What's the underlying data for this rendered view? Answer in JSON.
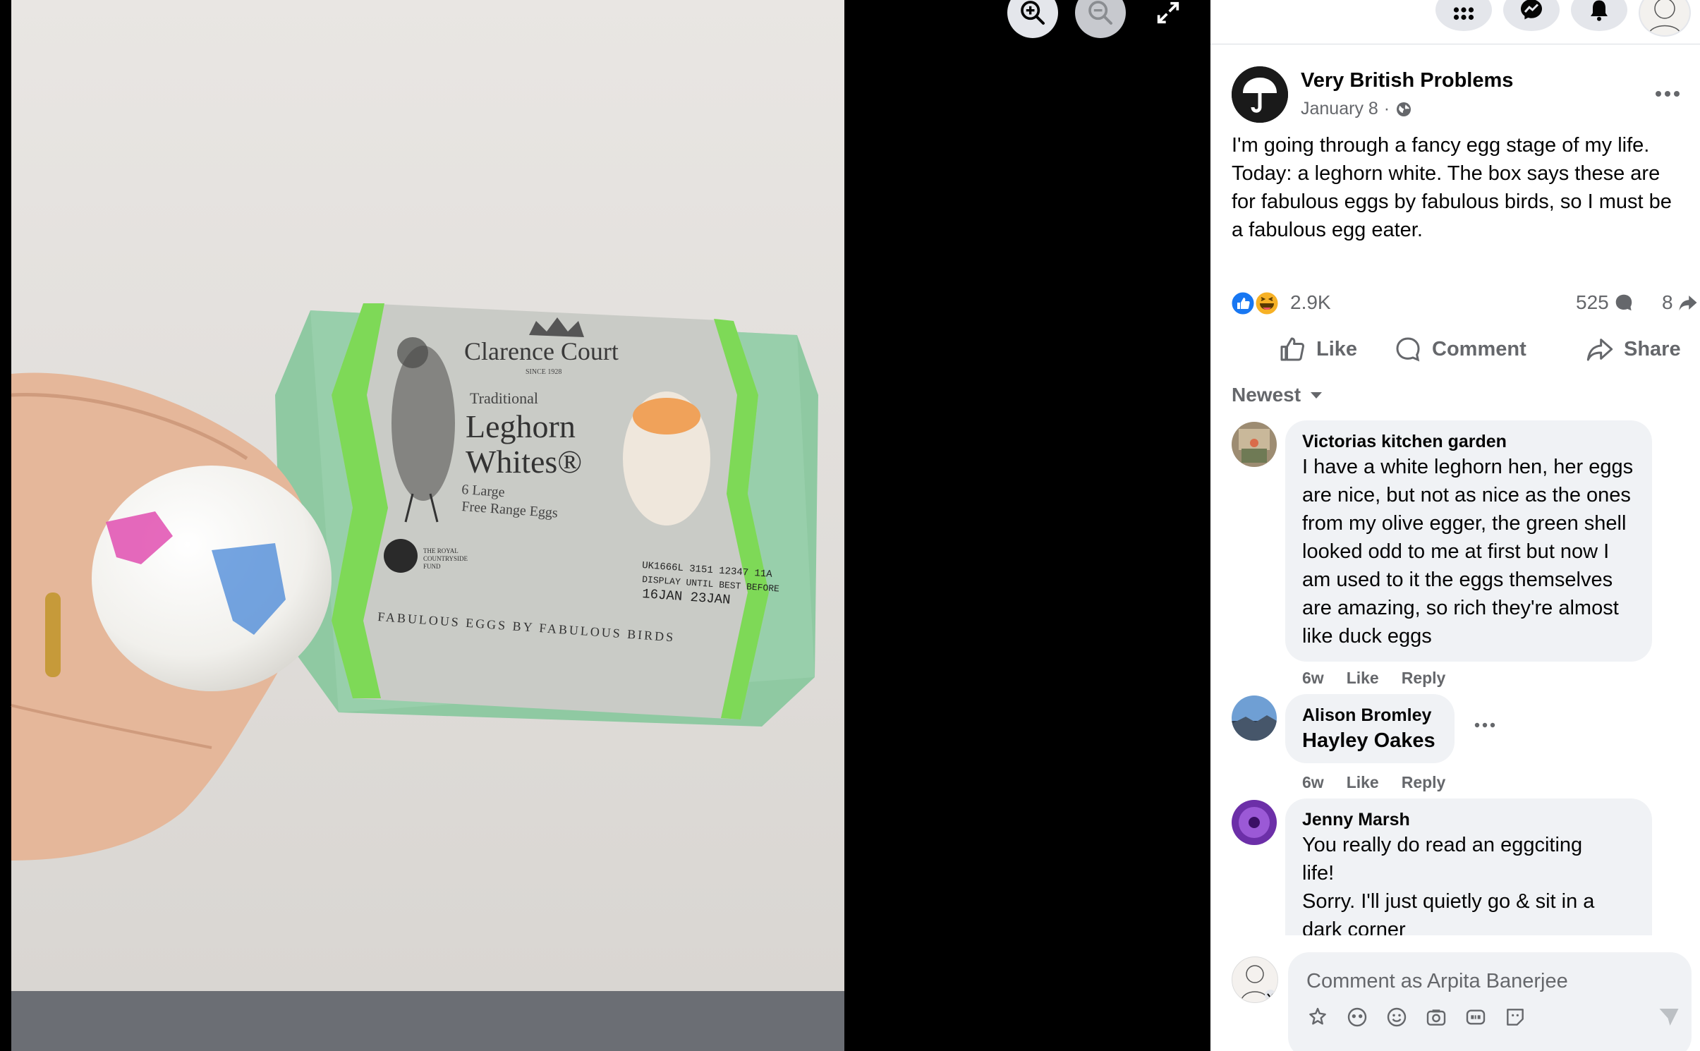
{
  "post": {
    "page_name": "Very British Problems",
    "date": "January 8",
    "separator": "·",
    "text": "I'm going through a fancy egg stage of my life. Today: a leghorn white. The box says these are for fabulous eggs by fabulous birds, so I must be a fabulous egg eater.",
    "reaction_count": "2.9K",
    "comment_count": "525",
    "share_count": "8"
  },
  "actions": {
    "like": "Like",
    "comment": "Comment",
    "share": "Share"
  },
  "sort": {
    "label": "Newest"
  },
  "comments": [
    {
      "author": "Victorias kitchen garden",
      "text": "I have a white leghorn hen, her eggs are nice, but not as nice as the ones from my olive egger, the green shell looked odd to me at first but now I am used to it the eggs themselves are amazing, so rich they're almost like duck eggs",
      "time": "6w",
      "like": "Like",
      "reply": "Reply"
    },
    {
      "author": "Alison Bromley",
      "text": "Hayley Oakes",
      "time": "6w",
      "like": "Like",
      "reply": "Reply"
    },
    {
      "author": "Jenny Marsh",
      "text_lines": [
        "You really do read an eggciting",
        "life!",
        "Sorry. I'll just quietly go & sit in a",
        "dark corner"
      ]
    }
  ],
  "composer": {
    "placeholder": "Comment as Arpita Banerjee"
  },
  "photo_text": {
    "brand": "Clarence Court",
    "since": "SINCE 1928",
    "traditional": "Traditional",
    "product_line1": "Leghorn",
    "product_line2": "Whites®",
    "desc_line1": "6 Large",
    "desc_line2": "Free Range Eggs",
    "tagline": "FABULOUS EGGS BY FABULOUS BIRDS",
    "fund_line1": "THE ROYAL",
    "fund_line2": "COUNTRYSIDE",
    "fund_line3": "FUND",
    "batch": "UK1666L 3151 12347 11A",
    "display_until": "DISPLAY UNTIL BEST BEFORE",
    "dates": "16JAN   23JAN"
  },
  "colors": {
    "accent": "#1877f2",
    "secondary_text": "#65676b",
    "bubble_bg": "#f0f2f5"
  }
}
